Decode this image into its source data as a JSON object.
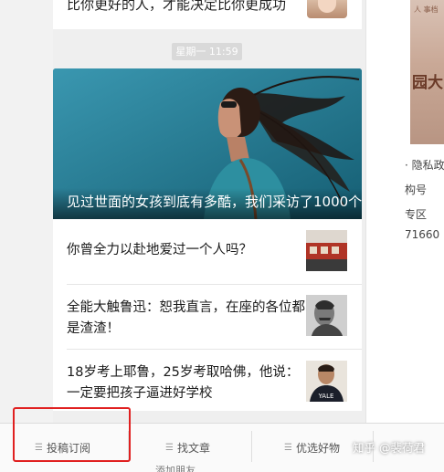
{
  "top_article": {
    "title": "比你更好的人，才能决定比你更成功"
  },
  "timestamp": "星期一 11:59",
  "hero": {
    "title": "见过世面的女孩到底有多酷，我们采访了1000个..."
  },
  "articles": [
    {
      "title": "你曾全力以赴地爱过一个人吗？"
    },
    {
      "title": "全能大触鲁迅：恕我直言，在座的各位都是渣渣！"
    },
    {
      "title": "18岁考上耶鲁，25岁考取哈佛，他说：一定要把孩子逼进好学校"
    }
  ],
  "thumb_text": {
    "yale": "YALE"
  },
  "right_panel": {
    "image_text": "园大",
    "image_small_text": "人\n事档",
    "lines": [
      "· 隐私政",
      "构号",
      "专区",
      "71660"
    ]
  },
  "menu": [
    {
      "label": "投稿订阅",
      "icon": "menu-list-icon"
    },
    {
      "label": "找文章",
      "icon": "menu-list-icon"
    },
    {
      "label": "优选好物",
      "icon": "menu-list-icon"
    }
  ],
  "watermark": "知乎 @裴荷君",
  "bottom_cutoff": "添加朋友",
  "colors": {
    "highlight": "#e02020",
    "hero_bg": "#1c7089",
    "timestamp_bg": "#d9d9d9"
  }
}
